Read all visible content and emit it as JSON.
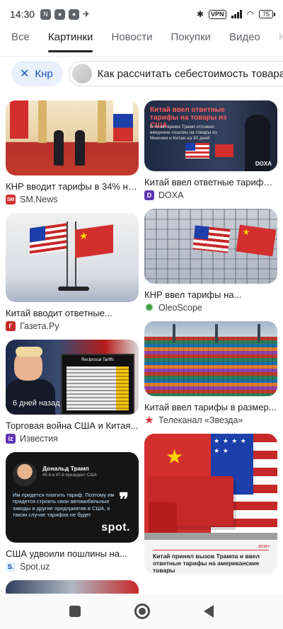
{
  "status_bar": {
    "time": "14:30",
    "left_icons": [
      "nfc-icon",
      "app-icon",
      "app-icon",
      "location-icon"
    ],
    "vpn": "VPN",
    "battery": "75"
  },
  "tabs": [
    {
      "label": "Все",
      "active": false
    },
    {
      "label": "Картинки",
      "active": true
    },
    {
      "label": "Новости",
      "active": false
    },
    {
      "label": "Покупки",
      "active": false
    },
    {
      "label": "Видео",
      "active": false
    },
    {
      "label": "К",
      "active": false
    }
  ],
  "chips": {
    "filter_label": "Кнр",
    "query_label": "Как рассчитать себестоимость товара"
  },
  "results": {
    "left": [
      {
        "caption": "КНР вводит тарифы в 34% на...",
        "source": "SM.News",
        "favicon": "SM",
        "favicon_color": "#d32f2f"
      },
      {
        "caption": "Китай вводит ответные...",
        "source": "Газета.Ру",
        "favicon": "Г",
        "favicon_color": "#c62828"
      },
      {
        "caption": "Торговая война США и Китая...",
        "source": "Известия",
        "favicon": "iz",
        "favicon_color": "#5e35b1",
        "overlay": "6 дней назад"
      },
      {
        "caption": "США удвоили пошлины на...",
        "source": "Spot.uz",
        "favicon": "S.",
        "favicon_color": "#0b3d91"
      }
    ],
    "right": [
      {
        "caption": "Китай ввел ответные тарифы...",
        "source": "DOXA",
        "favicon": "D",
        "favicon_color": "#5e35b1"
      },
      {
        "caption": "КНР ввел тарифы на...",
        "source": "OleoScope",
        "favicon": "✺",
        "favicon_color": "#43a047"
      },
      {
        "caption": "Китай ввел тарифы в размер...",
        "source": "Телеканал «Звезда»",
        "favicon": "★",
        "favicon_color": "#d32f2f"
      }
    ]
  },
  "image_text": {
    "doxa_title": "Китай ввел ответные тарифы на товары из США",
    "doxa_sub": "В то же время Трамп отложил введение пошлин на товары из Мексики и Китая на 30 дней",
    "doxa_logo": "DOXA",
    "board_title": "Reciprocal Tariffs",
    "spot_name": "Дональд Трамп",
    "spot_sub": "45-й и 47-й президент США",
    "spot_msg": "Им придется платить тариф. Поэтому им придется строить свои автомобильные заводы и другие предприятия в США, в таком случае тарифов не будет",
    "spot_brand": "spot.",
    "asia_tag": "asia+",
    "asia_caption": "Китай принял вызов Трампа и ввел ответные тарифы на американские товары"
  }
}
